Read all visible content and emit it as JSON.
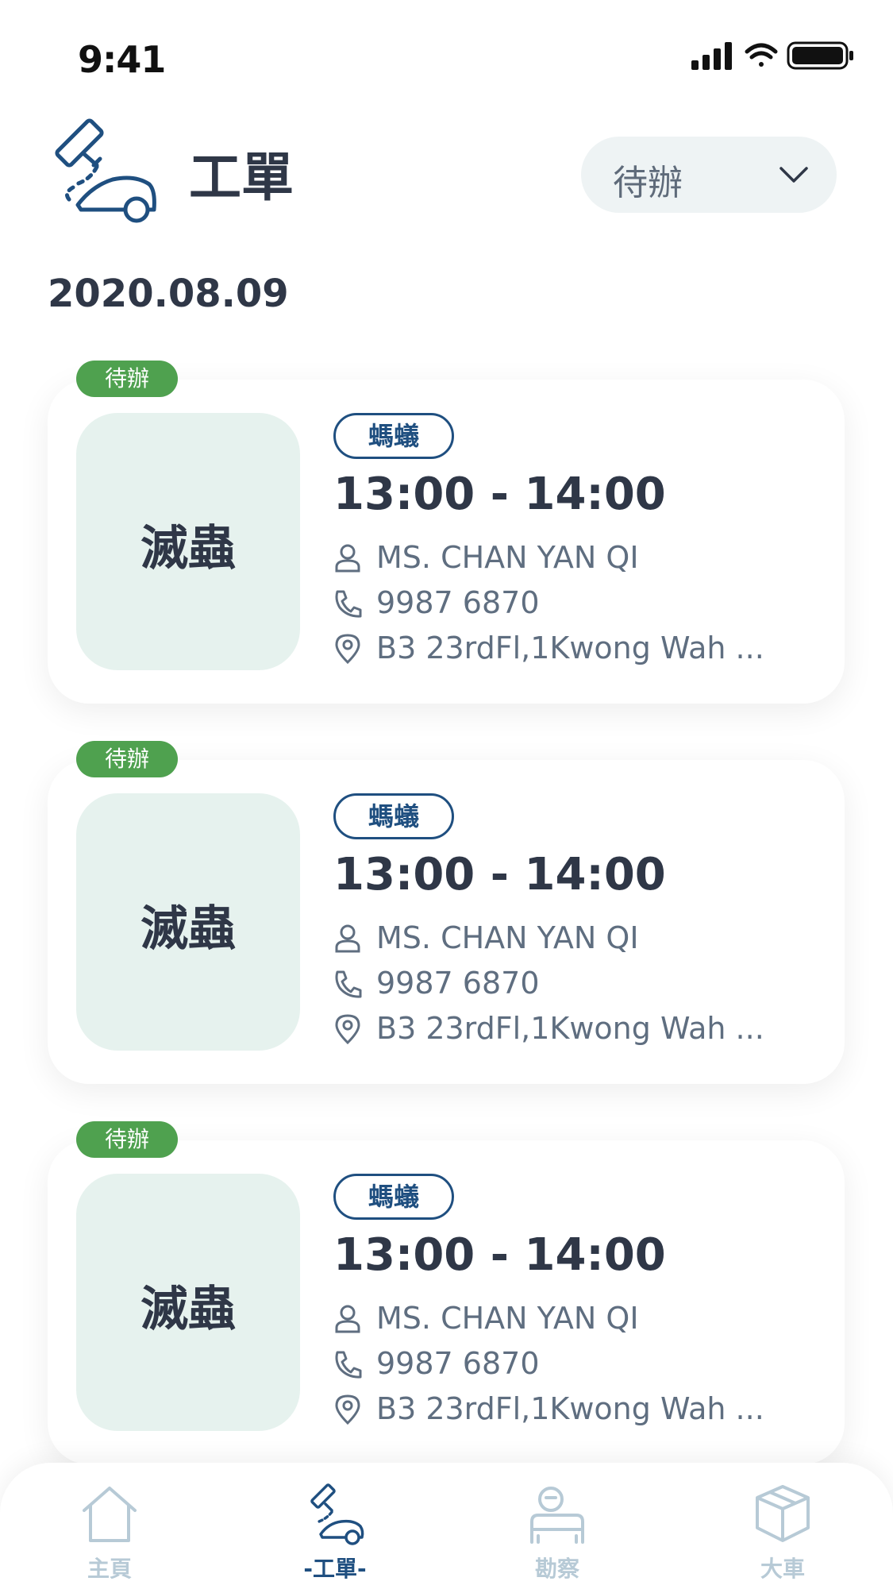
{
  "status_bar": {
    "time": "9:41"
  },
  "header": {
    "title": "工單",
    "filter": {
      "selected": "待辦"
    }
  },
  "date": "2020.08.09",
  "orders": [
    {
      "status": "待辦",
      "service": "滅蟲",
      "pest": "螞蟻",
      "time": "13:00 - 14:00",
      "contact": "MS. CHAN YAN QI",
      "phone": "9987 6870",
      "address": "B3 23rdFl,1Kwong Wah ..."
    },
    {
      "status": "待辦",
      "service": "滅蟲",
      "pest": "螞蟻",
      "time": "13:00 - 14:00",
      "contact": "MS. CHAN YAN QI",
      "phone": "9987 6870",
      "address": "B3 23rdFl,1Kwong Wah ..."
    },
    {
      "status": "待辦",
      "service": "滅蟲",
      "pest": "螞蟻",
      "time": "13:00 - 14:00",
      "contact": "MS. CHAN YAN QI",
      "phone": "9987 6870",
      "address": "B3 23rdFl,1Kwong Wah ..."
    }
  ],
  "nav": [
    {
      "label": "主頁",
      "icon": "home-icon",
      "active": false
    },
    {
      "label": "-工單-",
      "icon": "work-order-icon",
      "active": true
    },
    {
      "label": "勘察",
      "icon": "survey-icon",
      "active": false
    },
    {
      "label": "大車",
      "icon": "box-icon",
      "active": false
    }
  ],
  "colors": {
    "accent": "#1f4f80",
    "badge": "#4fa14f",
    "tile": "#e6f2ee",
    "nav_inactive": "#b7cad6"
  }
}
